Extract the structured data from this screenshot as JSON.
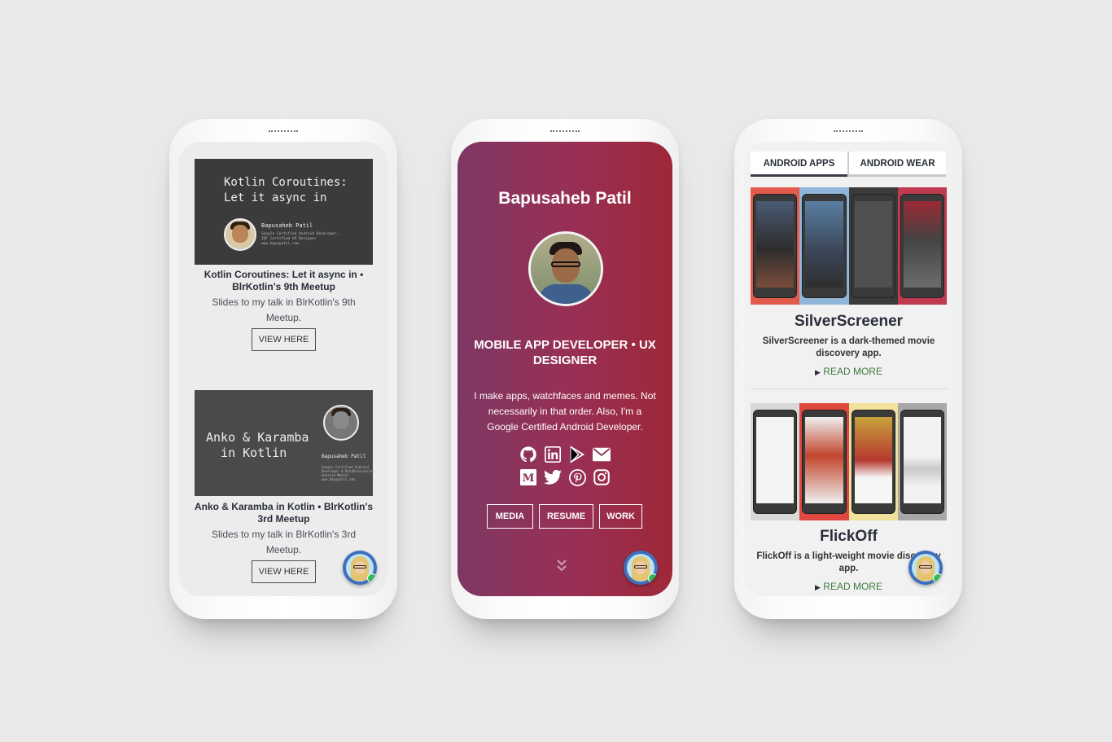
{
  "phone1": {
    "cards": [
      {
        "slide_title": "Kotlin Coroutines:\nLet it async in",
        "slide_author": "Bapusaheb Patil",
        "slide_meta": "Google Certified Android Developer,\nIDF Certified UX Designer\nwww.bapspatil.com",
        "title": "Kotlin Coroutines: Let it async in • BlrKotlin's 9th Meetup",
        "description": "Slides to my talk in BlrKotlin's 9th Meetup.",
        "button": "VIEW HERE"
      },
      {
        "slide_title": "Anko & Karamba\n  in Kotlin",
        "slide_author": "Bapusaheb Patil",
        "slide_meta": "Google Certified Android\nDeveloper & DataDiscoveries\nAndroid Mentor\nwww.bapspatil.com",
        "title": "Anko & Karamba in Kotlin • BlrKotlin's 3rd Meetup",
        "description": "Slides to my talk in BlrKotlin's 3rd Meetup.",
        "button": "VIEW HERE"
      }
    ]
  },
  "phone2": {
    "name": "Bapusaheb Patil",
    "role": "MOBILE APP DEVELOPER • UX DESIGNER",
    "bio": "I make apps, watchfaces and memes. Not necessarily in that order. Also, I'm a Google Certified Android Developer.",
    "social_icons": [
      "github-icon",
      "linkedin-icon",
      "google-play-icon",
      "email-icon",
      "medium-icon",
      "twitter-icon",
      "pinterest-icon",
      "instagram-icon"
    ],
    "buttons": {
      "media": "MEDIA",
      "resume": "RESUME",
      "work": "WORK"
    }
  },
  "phone3": {
    "tabs": [
      "ANDROID APPS",
      "ANDROID WEAR"
    ],
    "apps": [
      {
        "name": "SilverScreener",
        "description": "SilverScreener is a dark-themed movie discovery app.",
        "link": "READ MORE"
      },
      {
        "name": "FlickOff",
        "description": "FlickOff is a light-weight movie discovery app.",
        "link": "READ MORE"
      }
    ]
  },
  "colors": {
    "background": "#e9e9ea",
    "gradient_start": "#7e3763",
    "gradient_end": "#9e2838",
    "read_more": "#3d7a3e",
    "chat_online": "#2dbb55"
  }
}
